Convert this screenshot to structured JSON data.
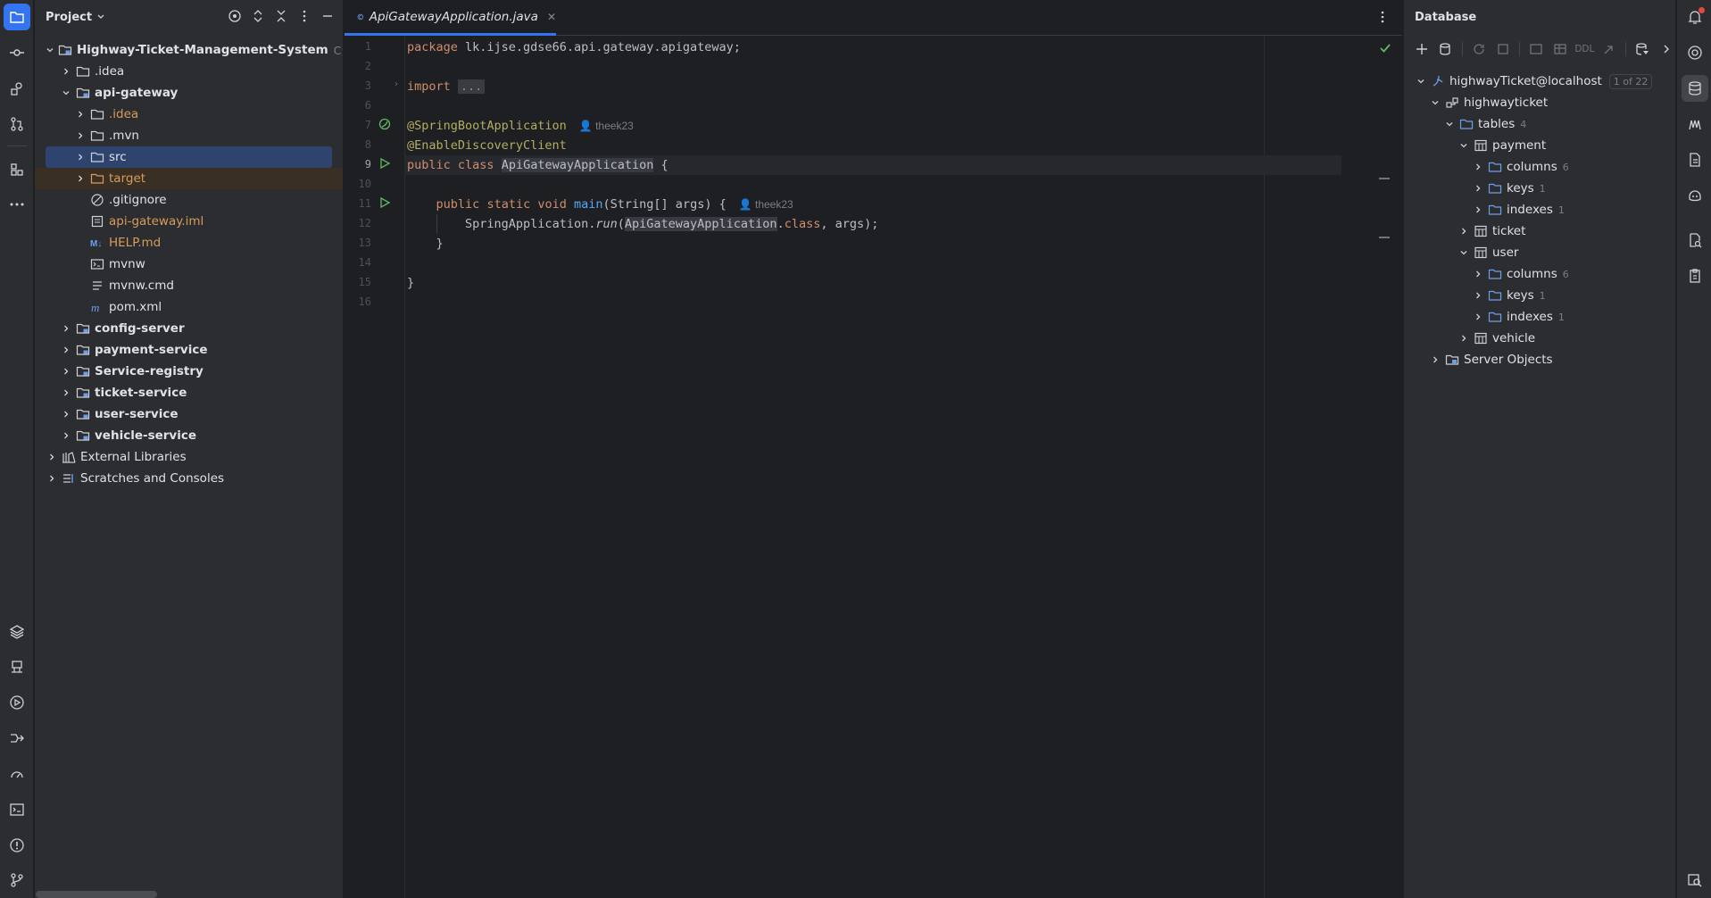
{
  "project_panel": {
    "title": "Project",
    "tree": [
      {
        "label": "Highway-Ticket-Management-System",
        "hint": "C:\\Work",
        "indent": 0,
        "chevron": "down",
        "icon": "module-folder-icon",
        "bold": true
      },
      {
        "label": ".idea",
        "indent": 1,
        "chevron": "right",
        "icon": "folder-icon"
      },
      {
        "label": "api-gateway",
        "indent": 1,
        "chevron": "down",
        "icon": "module-folder-icon",
        "bold": true
      },
      {
        "label": ".idea",
        "indent": 2,
        "chevron": "right",
        "icon": "folder-icon",
        "color": "orange"
      },
      {
        "label": ".mvn",
        "indent": 2,
        "chevron": "right",
        "icon": "folder-icon"
      },
      {
        "label": "src",
        "indent": 2,
        "chevron": "right",
        "icon": "folder-icon",
        "selected": true
      },
      {
        "label": "target",
        "indent": 2,
        "chevron": "right",
        "icon": "excluded-folder-icon",
        "color": "orange",
        "excluded": true
      },
      {
        "label": ".gitignore",
        "indent": 2,
        "chevron": "none",
        "icon": "gitignore-icon"
      },
      {
        "label": "api-gateway.iml",
        "indent": 2,
        "chevron": "none",
        "icon": "iml-file-icon",
        "color": "orange"
      },
      {
        "label": "HELP.md",
        "indent": 2,
        "chevron": "none",
        "icon": "markdown-icon",
        "color": "orange"
      },
      {
        "label": "mvnw",
        "indent": 2,
        "chevron": "none",
        "icon": "shell-file-icon"
      },
      {
        "label": "mvnw.cmd",
        "indent": 2,
        "chevron": "none",
        "icon": "text-file-icon"
      },
      {
        "label": "pom.xml",
        "indent": 2,
        "chevron": "none",
        "icon": "maven-icon"
      },
      {
        "label": "config-server",
        "indent": 1,
        "chevron": "right",
        "icon": "module-folder-icon",
        "bold": true
      },
      {
        "label": "payment-service",
        "indent": 1,
        "chevron": "right",
        "icon": "module-folder-icon",
        "bold": true
      },
      {
        "label": "Service-registry",
        "indent": 1,
        "chevron": "right",
        "icon": "module-folder-icon",
        "bold": true
      },
      {
        "label": "ticket-service",
        "indent": 1,
        "chevron": "right",
        "icon": "module-folder-icon",
        "bold": true
      },
      {
        "label": "user-service",
        "indent": 1,
        "chevron": "right",
        "icon": "module-folder-icon",
        "bold": true
      },
      {
        "label": "vehicle-service",
        "indent": 1,
        "chevron": "right",
        "icon": "module-folder-icon",
        "bold": true
      },
      {
        "label": "External Libraries",
        "indent": 0,
        "chevron": "right",
        "icon": "library-icon"
      },
      {
        "label": "Scratches and Consoles",
        "indent": 0,
        "chevron": "right",
        "icon": "scratches-icon"
      }
    ]
  },
  "editor": {
    "tab_label": "ApiGatewayApplication.java",
    "author": "theek23",
    "line_numbers": [
      "1",
      "2",
      "3",
      "6",
      "7",
      "8",
      "9",
      "10",
      "11",
      "12",
      "13",
      "14",
      "15",
      "16"
    ],
    "lines": {
      "l1": {
        "kw": "package",
        "rest": " lk.ijse.gdse66.api.gateway.apigateway;"
      },
      "l3": {
        "kw": "import",
        "fold": "..."
      },
      "l7": "@SpringBootApplication",
      "l8": "@EnableDiscoveryClient",
      "l9": {
        "kw1": "public",
        "kw2": "class",
        "name": "ApiGatewayApplication",
        "brace": " {"
      },
      "l11": {
        "kw1": "public",
        "kw2": "static",
        "kw3": "void",
        "fn": "main",
        "args": "(String[] args) {"
      },
      "l12": {
        "recv": "SpringApplication.",
        "call": "run",
        "open": "(",
        "cls": "ApiGatewayApplication",
        "dot": ".",
        "kw": "class",
        "rest": ", args);"
      },
      "l13": "}",
      "l15": "}"
    }
  },
  "database_panel": {
    "title": "Database",
    "toolbar_ddl": "DDL",
    "tree": [
      {
        "label": "highwayTicket@localhost",
        "pill": "1 of 22",
        "indent": 0,
        "chevron": "down",
        "icon": "datasource-icon"
      },
      {
        "label": "highwayticket",
        "indent": 1,
        "chevron": "down",
        "icon": "schema-icon"
      },
      {
        "label": "tables",
        "count": "4",
        "indent": 2,
        "chevron": "down",
        "icon": "folder-icon"
      },
      {
        "label": "payment",
        "indent": 3,
        "chevron": "down",
        "icon": "table-icon"
      },
      {
        "label": "columns",
        "count": "6",
        "indent": 4,
        "chevron": "right",
        "icon": "folder-icon"
      },
      {
        "label": "keys",
        "count": "1",
        "indent": 4,
        "chevron": "right",
        "icon": "folder-icon"
      },
      {
        "label": "indexes",
        "count": "1",
        "indent": 4,
        "chevron": "right",
        "icon": "folder-icon"
      },
      {
        "label": "ticket",
        "indent": 3,
        "chevron": "right",
        "icon": "table-icon"
      },
      {
        "label": "user",
        "indent": 3,
        "chevron": "down",
        "icon": "table-icon"
      },
      {
        "label": "columns",
        "count": "6",
        "indent": 4,
        "chevron": "right",
        "icon": "folder-icon"
      },
      {
        "label": "keys",
        "count": "1",
        "indent": 4,
        "chevron": "right",
        "icon": "folder-icon"
      },
      {
        "label": "indexes",
        "count": "1",
        "indent": 4,
        "chevron": "right",
        "icon": "folder-icon"
      },
      {
        "label": "vehicle",
        "indent": 3,
        "chevron": "right",
        "icon": "table-icon"
      },
      {
        "label": "Server Objects",
        "indent": 1,
        "chevron": "right",
        "icon": "server-objects-icon"
      }
    ]
  },
  "colors": {
    "accent": "#3574f0",
    "keyword": "#cf8e6d",
    "annotation": "#b3ae60",
    "method": "#56a8f5",
    "modified_file": "#d89b5c"
  }
}
